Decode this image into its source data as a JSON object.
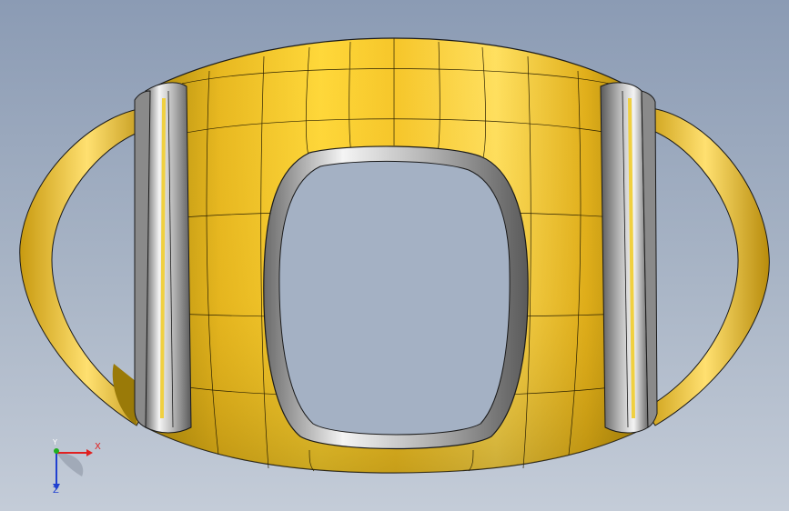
{
  "viewport": {
    "background_top": "#8b9bb4",
    "background_bottom": "#c4ccd8"
  },
  "model": {
    "surface_color": "#f0c020",
    "edge_color": "#1a1a1a",
    "chrome_color": "#c8c8c8"
  },
  "triad": {
    "x_label": "X",
    "y_label": "Y",
    "z_label": "Z",
    "x_color": "#e02020",
    "y_color": "#20b020",
    "z_color": "#2040d0"
  }
}
